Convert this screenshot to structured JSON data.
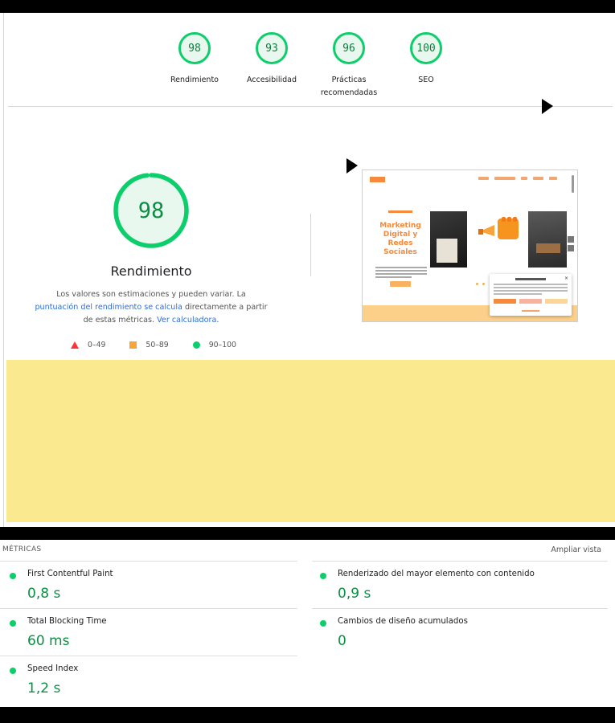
{
  "summary_scores": [
    {
      "score": "98",
      "label": "Rendimiento"
    },
    {
      "score": "93",
      "label": "Accesibilidad"
    },
    {
      "score": "96",
      "label": "Prácticas recomendadas"
    },
    {
      "score": "100",
      "label": "SEO"
    }
  ],
  "performance": {
    "score": "98",
    "score_fraction": 0.98,
    "title": "Rendimiento",
    "desc_prefix": "Los valores son estimaciones y pueden variar. La ",
    "desc_link1": "puntuación del rendimiento se calcula",
    "desc_middle": " directamente a partir de estas métricas. ",
    "desc_link2": "Ver calculadora",
    "desc_suffix": "."
  },
  "legend": {
    "fail": "0–49",
    "average": "50–89",
    "pass": "90–100"
  },
  "thumbnail": {
    "headline": "Marketing Digital y Redes Sociales"
  },
  "metrics": {
    "header": "MÉTRICAS",
    "expand_label": "Ampliar vista",
    "items": [
      {
        "label": "First Contentful Paint",
        "value": "0,8 s"
      },
      {
        "label": "Renderizado del mayor elemento con contenido",
        "value": "0,9 s"
      },
      {
        "label": "Total Blocking Time",
        "value": "60 ms"
      },
      {
        "label": "Cambios de diseño acumulados",
        "value": "0"
      },
      {
        "label": "Speed Index",
        "value": "1,2 s"
      }
    ]
  },
  "colors": {
    "pass": "#0cce6b",
    "pass_text": "#0a8f44",
    "average": "#f9a33b",
    "fail": "#ff3333",
    "link": "#2f6ed8",
    "highlight": "#fae98f"
  }
}
